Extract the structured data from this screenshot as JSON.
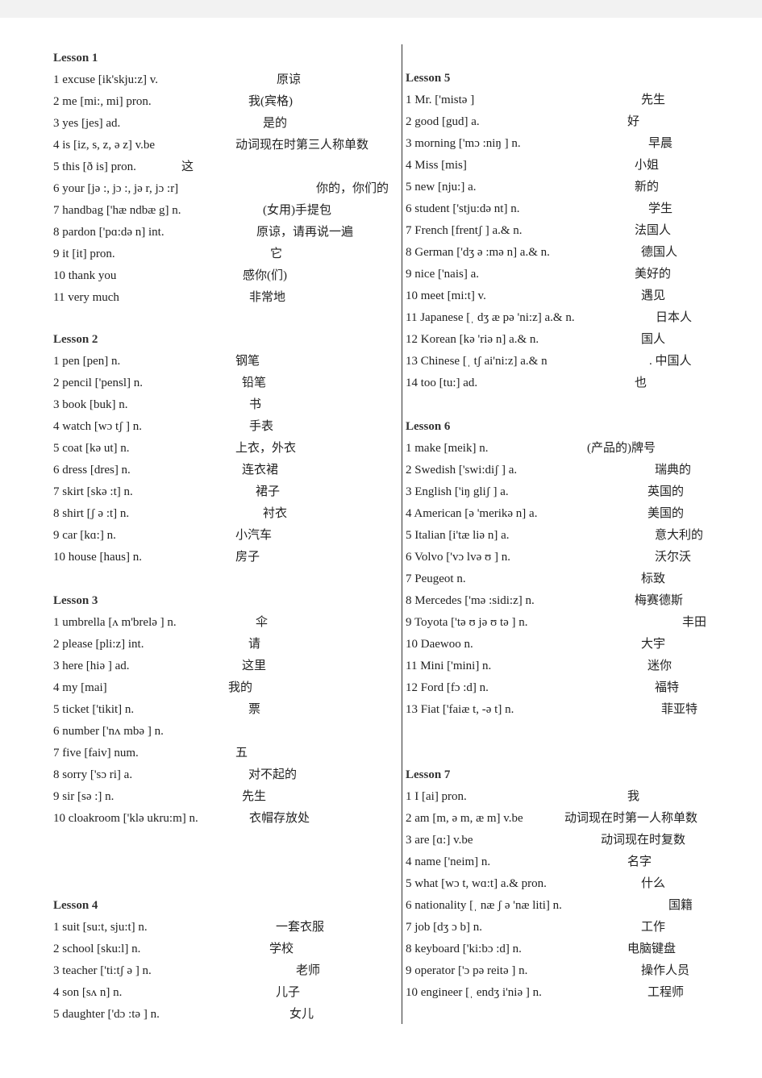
{
  "lessons": [
    {
      "title": "Lesson 1",
      "items": [
        {
          "en": "1 excuse [ik'skju:z] v.",
          "zh": "原谅"
        },
        {
          "en": "2 me [mi:, mi] pron.",
          "zh": "我(宾格)"
        },
        {
          "en": "3 yes [jes] ad.",
          "zh": "是的"
        },
        {
          "en": "4 is [iz, s, z, ə z] v.be",
          "zh": "动词现在时第三人称单数"
        },
        {
          "en": "5 this [ð is] pron.",
          "zh": "这"
        },
        {
          "en": "6 your [jə :, jɔ :, jə r, jɔ :r]",
          "zh": "你的，你们的"
        },
        {
          "en": "7 handbag ['hæ ndbæ g] n.",
          "zh": "(女用)手提包"
        },
        {
          "en": "8 pardon ['pɑ:də n] int.",
          "zh": "原谅，请再说一遍"
        },
        {
          "en": "9 it [it] pron.",
          "zh": "它"
        },
        {
          "en": "10 thank you",
          "zh": "感你(们)"
        },
        {
          "en": "11 very much",
          "zh": "非常地"
        }
      ]
    },
    {
      "title": "Lesson 2",
      "items": [
        {
          "en": "1 pen [pen] n.",
          "zh": "钢笔"
        },
        {
          "en": "2 pencil ['pensl] n.",
          "zh": "铅笔"
        },
        {
          "en": "3 book [buk] n.",
          "zh": "书"
        },
        {
          "en": "4 watch [wɔ tʃ ] n.",
          "zh": "手表"
        },
        {
          "en": "5 coat [kə ut] n.",
          "zh": "上衣，外衣"
        },
        {
          "en": "6 dress [dres] n.",
          "zh": "连衣裙"
        },
        {
          "en": "7 skirt [skə :t] n.",
          "zh": "裙子"
        },
        {
          "en": "8 shirt [ʃ ə :t] n.",
          "zh": "衬衣"
        },
        {
          "en": "9 car [kɑ:] n.",
          "zh": "小汽车"
        },
        {
          "en": "10 house [haus] n.",
          "zh": "房子"
        }
      ]
    },
    {
      "title": "Lesson 3",
      "items": [
        {
          "en": "1 umbrella [ʌ m'brelə ] n.",
          "zh": "伞"
        },
        {
          "en": "2 please [pli:z] int.",
          "zh": "请"
        },
        {
          "en": "3 here [hiə ] ad.",
          "zh": "这里"
        },
        {
          "en": "4 my [mai]",
          "zh": "我的"
        },
        {
          "en": "5 ticket ['tikit] n.",
          "zh": "票"
        },
        {
          "en": "6 number ['nʌ mbə ] n.",
          "zh": ""
        },
        {
          "en": "7 five [faiv] num.",
          "zh": "五"
        },
        {
          "en": "8 sorry ['sɔ ri] a.",
          "zh": "对不起的"
        },
        {
          "en": "9 sir [sə :] n.",
          "zh": "先生"
        },
        {
          "en": "10 cloakroom ['klə ukru:m] n.",
          "zh": "衣帽存放处"
        }
      ]
    },
    {
      "title": "Lesson 4",
      "items": [
        {
          "en": "1 suit [su:t, sju:t] n.",
          "zh": "一套衣服"
        },
        {
          "en": "2 school [sku:l] n.",
          "zh": "学校"
        },
        {
          "en": "3 teacher ['ti:tʃ ə ] n.",
          "zh": "老师"
        },
        {
          "en": "4 son [sʌ n] n.",
          "zh": "儿子"
        },
        {
          "en": "5 daughter ['dɔ :tə ] n.",
          "zh": "女儿"
        }
      ]
    },
    {
      "title": "Lesson 5",
      "items": [
        {
          "en": "1 Mr. ['mistə ]",
          "zh": "先生"
        },
        {
          "en": "2 good [gud] a.",
          "zh": "好"
        },
        {
          "en": "3 morning ['mɔ :niŋ ] n.",
          "zh": "早晨"
        },
        {
          "en": "4 Miss [mis]",
          "zh": "小姐"
        },
        {
          "en": "5 new [nju:] a.",
          "zh": "新的"
        },
        {
          "en": "6 student ['stju:də nt] n.",
          "zh": "学生"
        },
        {
          "en": "7 French [frentʃ ] a.& n.",
          "zh": "法国人"
        },
        {
          "en": "8 German ['dʒ ə :mə n] a.& n.",
          "zh": "德国人"
        },
        {
          "en": "9 nice ['nais] a.",
          "zh": "美好的"
        },
        {
          "en": "10 meet [mi:t] v.",
          "zh": "遇见"
        },
        {
          "en": "11 Japanese [ˌ dʒ æ pə 'ni:z] a.& n.",
          "zh": "日本人"
        },
        {
          "en": "12 Korean [kə 'riə n] a.& n.",
          "zh": "国人"
        },
        {
          "en": "13 Chinese [ˌ tʃ ai'ni:z] a.& n",
          "zh": ". 中国人"
        },
        {
          "en": "14 too [tu:] ad.",
          "zh": "也"
        }
      ]
    },
    {
      "title": "Lesson 6",
      "items": [
        {
          "en": "1 make [meik] n.",
          "zh": "(产品的)牌号"
        },
        {
          "en": "2 Swedish ['swi:diʃ ] a.",
          "zh": "瑞典的"
        },
        {
          "en": "3 English ['iŋ gliʃ ] a.",
          "zh": "英国的"
        },
        {
          "en": "4 American [ə 'merikə n] a.",
          "zh": "美国的"
        },
        {
          "en": "5 Italian [i'tæ liə n] a.",
          "zh": "意大利的"
        },
        {
          "en": "6 Volvo ['vɔ lvə ʊ ] n.",
          "zh": "沃尔沃"
        },
        {
          "en": "7 Peugeot n.",
          "zh": "标致"
        },
        {
          "en": "8 Mercedes ['mə :sidi:z] n.",
          "zh": "梅赛德斯"
        },
        {
          "en": "9 Toyota ['tə ʊ jə ʊ tə ] n.",
          "zh": "丰田"
        },
        {
          "en": "10 Daewoo n.",
          "zh": "大宇"
        },
        {
          "en": "11 Mini ['mini] n.",
          "zh": "迷你"
        },
        {
          "en": "12 Ford [fɔ :d] n.",
          "zh": "福特"
        },
        {
          "en": "13 Fiat ['faiæ t, -ə t] n.",
          "zh": "菲亚特"
        }
      ]
    },
    {
      "title": "Lesson 7",
      "items": [
        {
          "en": "1 I [ai] pron.",
          "zh": "我"
        },
        {
          "en": "2 am [m, ə m, æ m] v.be",
          "zh": "动词现在时第一人称单数"
        },
        {
          "en": "3 are [ɑ:] v.be",
          "zh": "动词现在时复数"
        },
        {
          "en": "4 name ['neim] n.",
          "zh": "名字"
        },
        {
          "en": "5 what [wɔ t, wɑ:t] a.& pron.",
          "zh": "什么"
        },
        {
          "en": "6 nationality [ˌ næ ʃ ə 'næ liti] n.",
          "zh": "国籍"
        },
        {
          "en": "7 job [dʒ ɔ b] n.",
          "zh": "工作"
        },
        {
          "en": "8 keyboard ['ki:bɔ :d] n.",
          "zh": "电脑键盘"
        },
        {
          "en": "9 operator ['ɔ pə reitə ] n.",
          "zh": "操作人员"
        },
        {
          "en": "10 engineer [ˌ endʒ i'niə ] n.",
          "zh": "工程师"
        }
      ]
    }
  ]
}
